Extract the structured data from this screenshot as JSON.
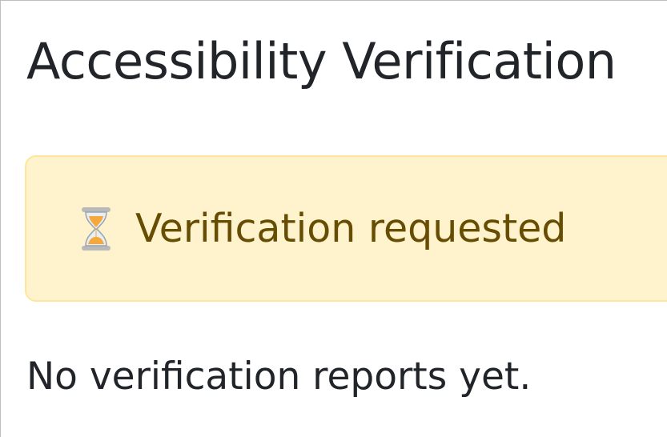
{
  "page": {
    "title": "Accessibility Verification"
  },
  "status": {
    "icon": "hourglass-icon",
    "label": "Verification requested",
    "background": "#fff3cd",
    "border": "#ffe69c",
    "text_color": "#664d03"
  },
  "reports": {
    "empty_message": "No verification reports yet."
  }
}
